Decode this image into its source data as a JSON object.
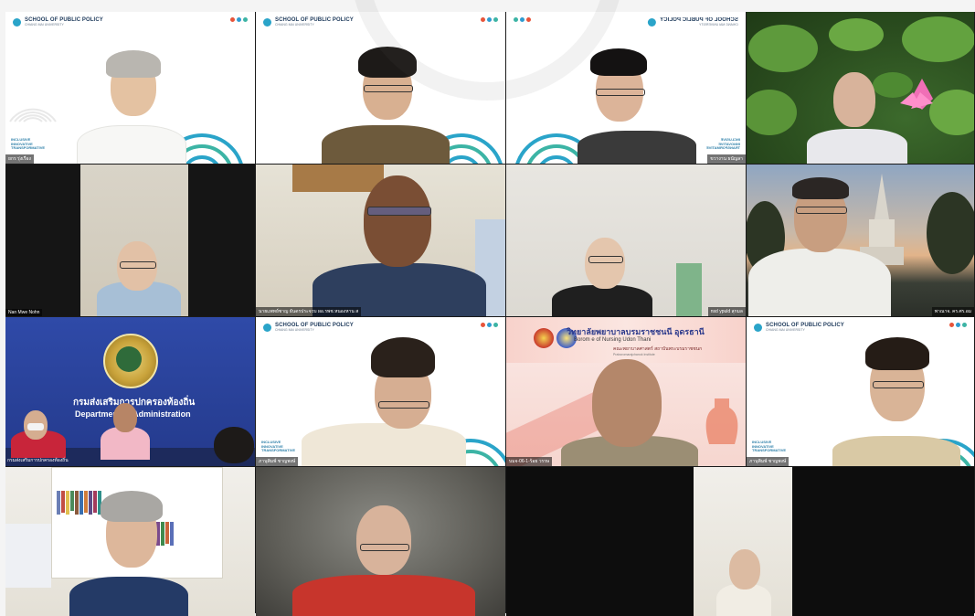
{
  "participants": [
    {
      "id": "p1",
      "name_label": "ยกร รุ่งเรือง",
      "branding": "School of Public Policy"
    },
    {
      "id": "p2",
      "name_label": "",
      "branding": "School of Public Policy"
    },
    {
      "id": "p3",
      "name_label": "ขวางาน ธนัญลา",
      "branding": "School of Public Policy"
    },
    {
      "id": "p4",
      "name_label": ""
    },
    {
      "id": "p5",
      "name_label": "Nan Mwe Nohn"
    },
    {
      "id": "p6",
      "name_label": "นายแพทย์ชาญ ธันดรประจวบ ผอ.รพช.หนองหาน ส"
    },
    {
      "id": "p7",
      "name_label": "nsd ypuld สุกมล"
    },
    {
      "id": "p8",
      "name_label": "พาณาจ. คร.ศร.อม"
    },
    {
      "id": "p9",
      "name_label": "กรมส่งเสริมการปกครองท้องถิ่น"
    },
    {
      "id": "p10",
      "name_label": "ภานุพิมพ์ ชาญพงษ์",
      "branding": "School of Public Policy"
    },
    {
      "id": "p11",
      "name_label": "บมจ-06-1-ร้อย วรรษ"
    },
    {
      "id": "p12",
      "name_label": "ภานุพิมพ์ ชาญพงษ์",
      "branding": "School of Public Policy"
    },
    {
      "id": "p13",
      "name_label": ""
    },
    {
      "id": "p14",
      "name_label": ""
    },
    {
      "id": "p15",
      "name_label": ""
    }
  ],
  "spp": {
    "title": "SCHOOL OF PUBLIC POLICY",
    "sub": "CHIANG MAI UNIVERSITY",
    "tagline": [
      "INCLUSIVE",
      "INNOVATIVE",
      "TRANSFORMATIVE"
    ]
  },
  "dept": {
    "thai": "กรมส่งเสริมการปกครองท้องถิ่น",
    "english": "Department of      Administration"
  },
  "udon": {
    "thai": "วิทยาลัยพยาบาลบรมราชชนนี อุดรธานี",
    "english": "Borom              e of Nursing  Udon Thani",
    "thai_sub": "คณะพยาบาลศาสตร์ สถาบันพระบรมราชชนก",
    "inst": "Praboromarajchanok Institute"
  },
  "colors": {
    "spp_blue": "#2aa4c9",
    "spp_teal": "#3cb4a5",
    "spp_navy": "#1f3b5c",
    "dept_blue": "#2f4aa8",
    "udon_navy": "#2c3a8c"
  },
  "icons": {
    "fingerprint": "fingerprint-icon",
    "dots": "brand-dots-icon",
    "emblem": "department-emblem-icon",
    "seal": "college-seal-icon"
  }
}
